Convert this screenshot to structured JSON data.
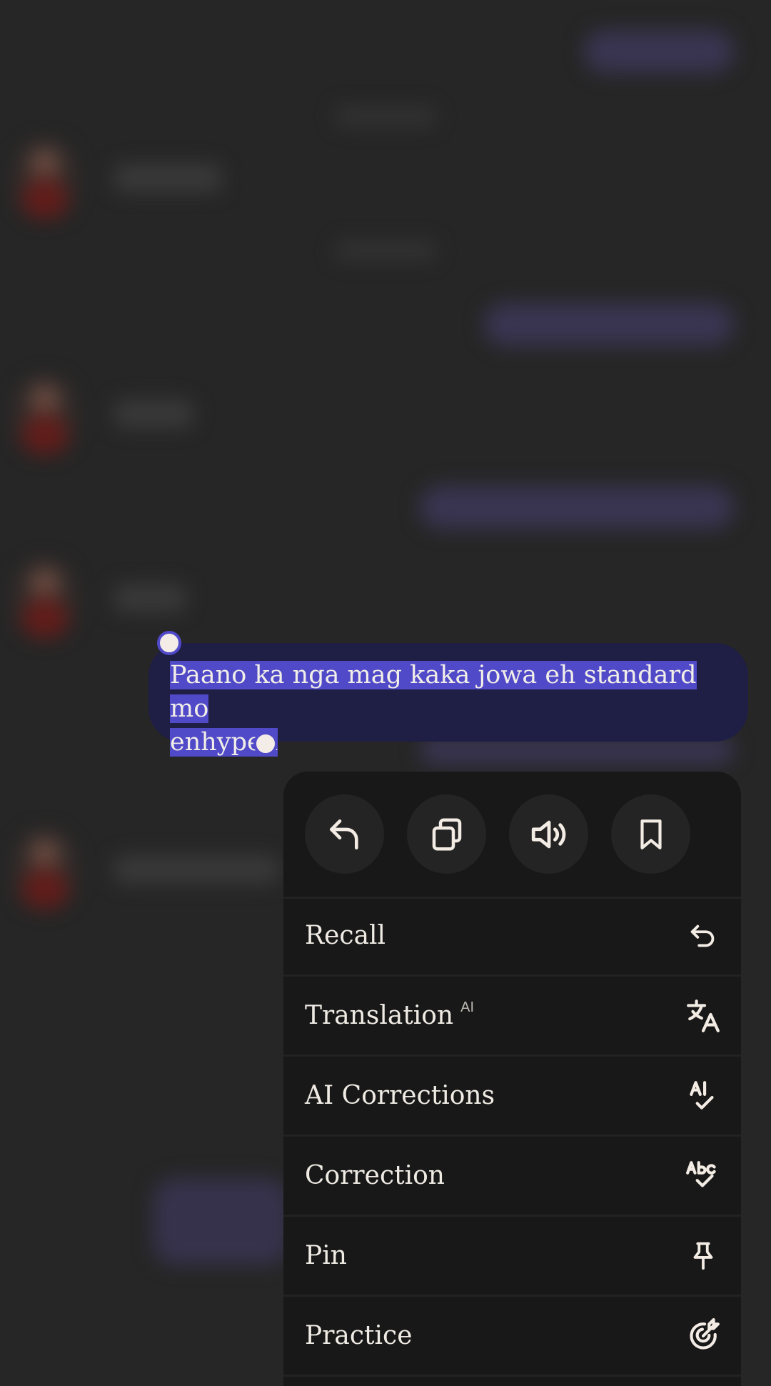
{
  "selected_message": {
    "text_line1": "Paano ka nga mag kaka jowa eh standard mo",
    "text_line2": "enhypen"
  },
  "action_bar": [
    {
      "name": "reply-button",
      "icon": "reply-icon"
    },
    {
      "name": "copy-button",
      "icon": "copy-icon"
    },
    {
      "name": "speak-button",
      "icon": "speaker-icon"
    },
    {
      "name": "bookmark-button",
      "icon": "bookmark-icon"
    }
  ],
  "menu": {
    "recall": "Recall",
    "translation": "Translation",
    "translation_badge": "AI",
    "ai_corrections": "AI Corrections",
    "correction": "Correction",
    "pin": "Pin",
    "practice": "Practice"
  },
  "colors": {
    "selection": "#5049c8",
    "bubble": "#1f1e45",
    "menu_bg": "#181818",
    "icon": "#f3ece4"
  }
}
